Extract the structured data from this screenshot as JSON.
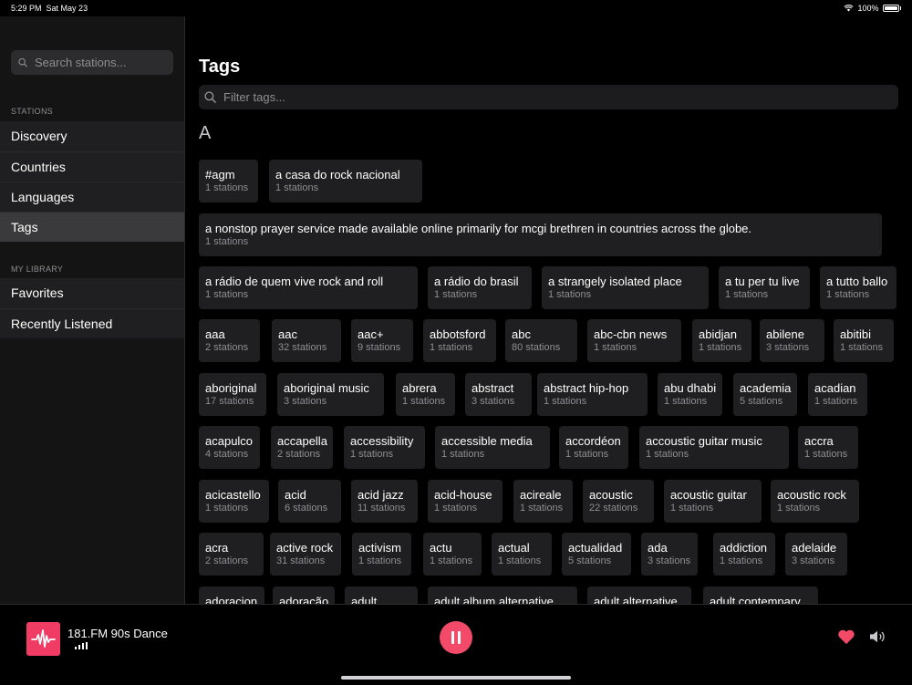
{
  "status_bar": {
    "time": "5:29 PM",
    "date": "Sat May 23",
    "battery": "100%"
  },
  "sidebar": {
    "search_placeholder": "Search stations...",
    "stations_label": "STATIONS",
    "stations_items": [
      "Discovery",
      "Countries",
      "Languages",
      "Tags"
    ],
    "active_item": "Tags",
    "library_label": "MY LIBRARY",
    "library_items": [
      "Favorites",
      "Recently Listened"
    ]
  },
  "main": {
    "title": "Tags",
    "filter_placeholder": "Filter tags...",
    "section_letter": "A",
    "tags": [
      {
        "name": "#agm",
        "count": "1 stations"
      },
      {
        "name": "a casa do rock nacional",
        "count": "1 stations"
      },
      {
        "name": "a nonstop prayer service made available online primarily for mcgi brethren  in countries across the globe.",
        "count": "1 stations"
      },
      {
        "name": "a rádio de quem vive rock and roll",
        "count": "1 stations"
      },
      {
        "name": "a rádio do brasil",
        "count": "1 stations"
      },
      {
        "name": "a strangely isolated place",
        "count": "1 stations"
      },
      {
        "name": "a tu per tu live",
        "count": "1 stations"
      },
      {
        "name": "a tutto ballo",
        "count": "1 stations"
      },
      {
        "name": "aaa",
        "count": "2 stations"
      },
      {
        "name": "aac",
        "count": "32 stations"
      },
      {
        "name": "aac+",
        "count": "9 stations"
      },
      {
        "name": "abbotsford",
        "count": "1 stations"
      },
      {
        "name": "abc",
        "count": "80 stations"
      },
      {
        "name": "abc-cbn news",
        "count": "1 stations"
      },
      {
        "name": "abidjan",
        "count": "1 stations"
      },
      {
        "name": "abilene",
        "count": "3 stations"
      },
      {
        "name": "abitibi",
        "count": "1 stations"
      },
      {
        "name": "aboriginal",
        "count": "17 stations"
      },
      {
        "name": "aboriginal music",
        "count": "3 stations"
      },
      {
        "name": "abrera",
        "count": "1 stations"
      },
      {
        "name": "abstract",
        "count": "3 stations"
      },
      {
        "name": "abstract hip-hop",
        "count": "1 stations"
      },
      {
        "name": "abu dhabi",
        "count": "1 stations"
      },
      {
        "name": "academia",
        "count": "5 stations"
      },
      {
        "name": "acadian",
        "count": "1 stations"
      },
      {
        "name": "acapulco",
        "count": "4 stations"
      },
      {
        "name": "accapella",
        "count": "2 stations"
      },
      {
        "name": "accessibility",
        "count": "1 stations"
      },
      {
        "name": "accessible media",
        "count": "1 stations"
      },
      {
        "name": "accordéon",
        "count": "1 stations"
      },
      {
        "name": "accoustic guitar music",
        "count": "1 stations"
      },
      {
        "name": "accra",
        "count": "1 stations"
      },
      {
        "name": "acicastello",
        "count": "1 stations"
      },
      {
        "name": "acid",
        "count": "6 stations"
      },
      {
        "name": "acid jazz",
        "count": "11 stations"
      },
      {
        "name": "acid-house",
        "count": "1 stations"
      },
      {
        "name": "acireale",
        "count": "1 stations"
      },
      {
        "name": "acoustic",
        "count": "22 stations"
      },
      {
        "name": "acoustic guitar",
        "count": "1 stations"
      },
      {
        "name": "acoustic rock",
        "count": "1 stations"
      },
      {
        "name": "acra",
        "count": "2 stations"
      },
      {
        "name": "active rock",
        "count": "31 stations"
      },
      {
        "name": "activism",
        "count": "1 stations"
      },
      {
        "name": "actu",
        "count": "1 stations"
      },
      {
        "name": "actual",
        "count": "1 stations"
      },
      {
        "name": "actualidad",
        "count": "5 stations"
      },
      {
        "name": "ada",
        "count": "3 stations"
      },
      {
        "name": "addiction",
        "count": "1 stations"
      },
      {
        "name": "adelaide",
        "count": "3 stations"
      },
      {
        "name": "adoracion",
        "count": ""
      },
      {
        "name": "adoração",
        "count": ""
      },
      {
        "name": "adult",
        "count": ""
      },
      {
        "name": "adult album alternative",
        "count": ""
      },
      {
        "name": "adult alternative",
        "count": ""
      },
      {
        "name": "adult contempary",
        "count": ""
      }
    ]
  },
  "player": {
    "station": "181.FM 90s Dance",
    "favorite_icon": "heart-icon",
    "volume_icon": "speaker-icon",
    "accent_color": "#f24a68"
  }
}
